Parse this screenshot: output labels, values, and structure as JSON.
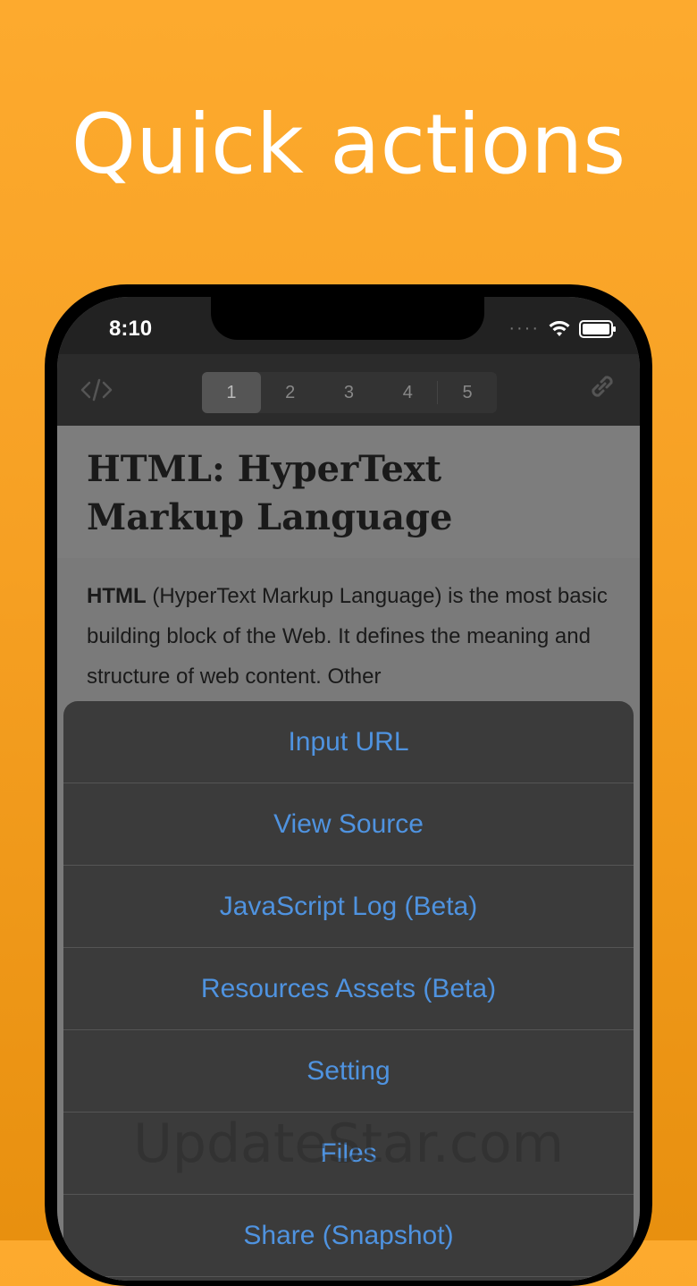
{
  "headline": "Quick actions",
  "status_bar": {
    "time": "8:10",
    "icons": [
      "signal-dots-icon",
      "wifi-icon",
      "battery-icon"
    ]
  },
  "toolbar": {
    "left_icon": "code-icon",
    "right_icon": "link-icon",
    "tabs": [
      "1",
      "2",
      "3",
      "4",
      "5"
    ],
    "active_tab": "1"
  },
  "article": {
    "title": "HTML: HyperText Markup Language",
    "lead_bold": "HTML",
    "lead_rest": " (HyperText Markup Language) is the most basic building block of the Web. It defines the meaning and structure of web content. Other"
  },
  "actions": [
    "Input URL",
    "View Source",
    "JavaScript Log (Beta)",
    "Resources Assets (Beta)",
    "Setting",
    "Files",
    "Share (Snapshot)"
  ],
  "watermark": "UpdateStar.com",
  "colors": {
    "background_top": "#FDAA2E",
    "background_bottom": "#E8900F",
    "action_text": "#4f93e0",
    "sheet_bg": "#3b3b3b"
  }
}
